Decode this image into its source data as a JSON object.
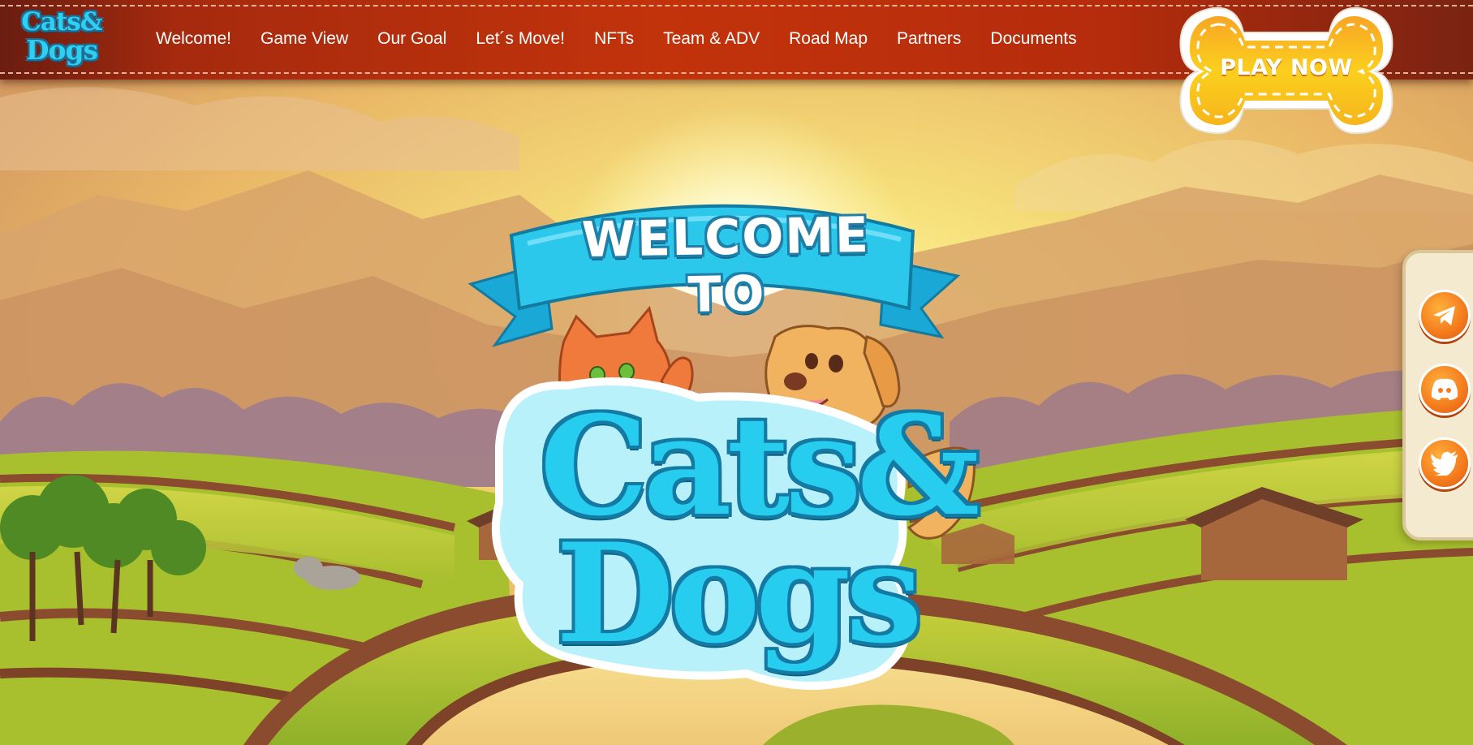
{
  "header": {
    "logo": {
      "line1": "Cats&",
      "line2": "Dogs"
    },
    "nav": [
      {
        "label": "Welcome!"
      },
      {
        "label": "Game View"
      },
      {
        "label": "Our Goal"
      },
      {
        "label": "Let´s Move!"
      },
      {
        "label": "NFTs"
      },
      {
        "label": "Team & ADV"
      },
      {
        "label": "Road Map"
      },
      {
        "label": "Partners"
      },
      {
        "label": "Documents"
      }
    ],
    "play_button": {
      "label": "PLAY NOW"
    }
  },
  "hero": {
    "ribbon_text": "WELCOME TO",
    "brand_line1": "Cats&",
    "brand_line2": "Dogs"
  },
  "social": [
    {
      "icon": "telegram-icon"
    },
    {
      "icon": "discord-icon"
    },
    {
      "icon": "twitter-icon"
    }
  ],
  "colors": {
    "header_red": "#c2330b",
    "brand_cyan": "#27cdee",
    "button_yellow": "#f9c51c",
    "social_orange": "#f47a1c"
  }
}
